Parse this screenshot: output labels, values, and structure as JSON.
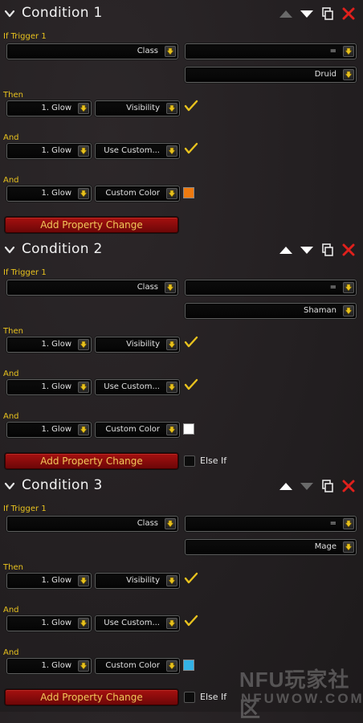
{
  "conditions": [
    {
      "title": "Condition 1",
      "if_label": "If Trigger 1",
      "trigger_property": "Class",
      "operator": "=",
      "value": "Druid",
      "rows": [
        {
          "label": "Then",
          "target": "1. Glow",
          "property": "Visibility",
          "control": "check"
        },
        {
          "label": "And",
          "target": "1. Glow",
          "property": "Use Custom...",
          "control": "check"
        },
        {
          "label": "And",
          "target": "1. Glow",
          "property": "Custom Color",
          "control": "swatch",
          "color": "#ee7a10"
        }
      ],
      "add_label": "Add Property Change",
      "move_up_enabled": false,
      "move_down_enabled": true,
      "has_else_if": false
    },
    {
      "title": "Condition 2",
      "if_label": "If Trigger 1",
      "trigger_property": "Class",
      "operator": "=",
      "value": "Shaman",
      "rows": [
        {
          "label": "Then",
          "target": "1. Glow",
          "property": "Visibility",
          "control": "check"
        },
        {
          "label": "And",
          "target": "1. Glow",
          "property": "Use Custom...",
          "control": "check"
        },
        {
          "label": "And",
          "target": "1. Glow",
          "property": "Custom Color",
          "control": "swatch",
          "color": "#ffffff"
        }
      ],
      "add_label": "Add Property Change",
      "move_up_enabled": true,
      "move_down_enabled": true,
      "has_else_if": true,
      "else_if_label": "Else If"
    },
    {
      "title": "Condition 3",
      "if_label": "If Trigger 1",
      "trigger_property": "Class",
      "operator": "=",
      "value": "Mage",
      "rows": [
        {
          "label": "Then",
          "target": "1. Glow",
          "property": "Visibility",
          "control": "check"
        },
        {
          "label": "And",
          "target": "1. Glow",
          "property": "Use Custom...",
          "control": "check"
        },
        {
          "label": "And",
          "target": "1. Glow",
          "property": "Custom Color",
          "control": "swatch",
          "color": "#33b2e6"
        }
      ],
      "add_label": "Add Property Change",
      "move_up_enabled": true,
      "move_down_enabled": false,
      "has_else_if": true,
      "else_if_label": "Else If"
    }
  ],
  "watermark": {
    "top": "NFU玩家社区",
    "bottom": "NFUWOW.COM"
  },
  "colors": {
    "label_yellow": "#e8c21e",
    "button_red": "#a5100f",
    "check_yellow": "#e8c21e",
    "delete_red": "#e0201c"
  }
}
